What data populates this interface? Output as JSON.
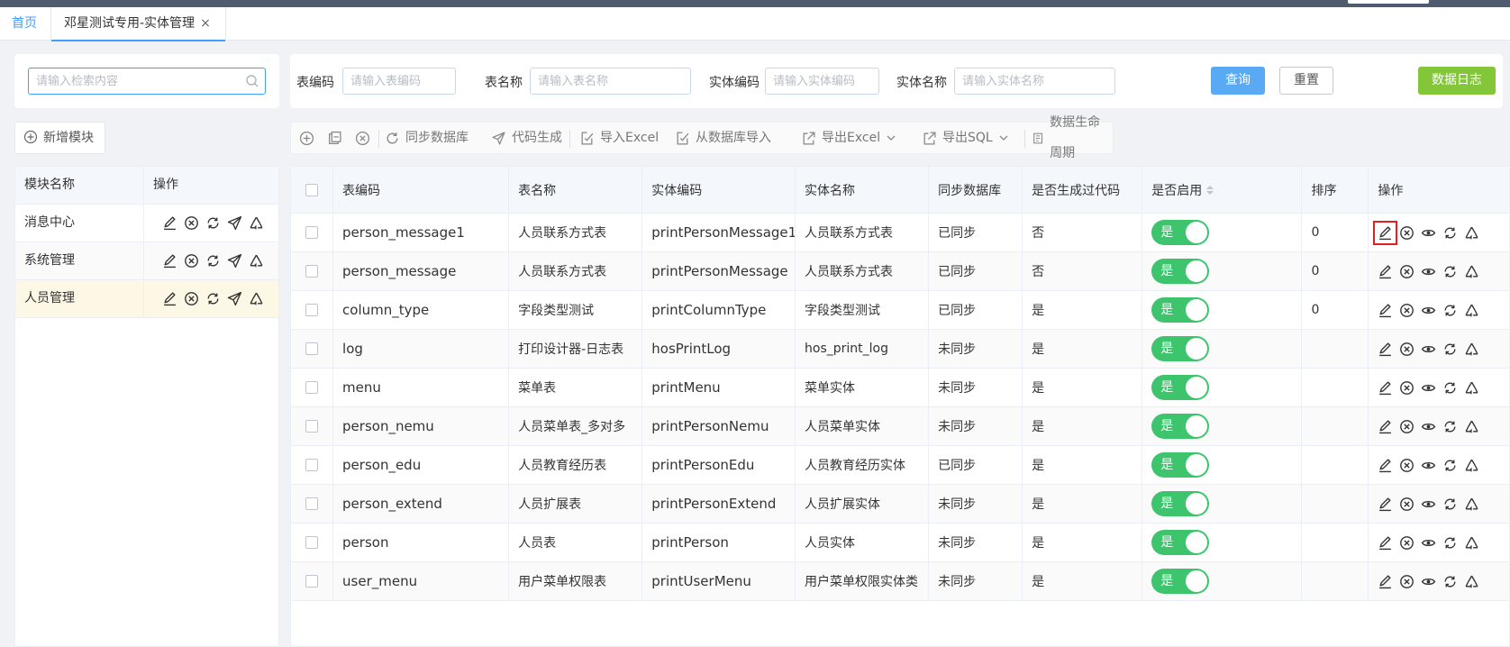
{
  "tabs": {
    "home": "首页",
    "active": "邓星测试专用-实体管理",
    "close": "×"
  },
  "left": {
    "search_placeholder": "请输入检索内容",
    "add_module": "新增模块",
    "header": {
      "name": "模块名称",
      "ops": "操作"
    },
    "modules": [
      {
        "name": "消息中心"
      },
      {
        "name": "系统管理"
      },
      {
        "name": "人员管理"
      }
    ]
  },
  "filters": {
    "table_code_label": "表编码",
    "table_code_placeholder": "请输入表编码",
    "table_name_label": "表名称",
    "table_name_placeholder": "请输入表名称",
    "entity_code_label": "实体编码",
    "entity_code_placeholder": "请输入实体编码",
    "entity_name_label": "实体名称",
    "entity_name_placeholder": "请输入实体名称",
    "query": "查询",
    "reset": "重置",
    "data_log": "数据日志"
  },
  "toolbar": {
    "sync_db": "同步数据库",
    "code_gen": "代码生成",
    "import_excel": "导入Excel",
    "import_db": "从数据库导入",
    "export_excel": "导出Excel",
    "export_sql": "导出SQL",
    "lifecycle": "数据生命周期"
  },
  "table": {
    "headers": {
      "code": "表编码",
      "name": "表名称",
      "ecode": "实体编码",
      "ename": "实体名称",
      "sync": "同步数据库",
      "gen": "是否生成过代码",
      "enable": "是否启用",
      "sort": "排序",
      "ops": "操作"
    },
    "rows": [
      {
        "code": "person_message1",
        "name": "人员联系方式表",
        "ecode": "printPersonMessage1",
        "ename": "人员联系方式表",
        "sync": "已同步",
        "gen": "否",
        "enable": "是",
        "sort": "0"
      },
      {
        "code": "person_message",
        "name": "人员联系方式表",
        "ecode": "printPersonMessage",
        "ename": "人员联系方式表",
        "sync": "已同步",
        "gen": "否",
        "enable": "是",
        "sort": "0"
      },
      {
        "code": "column_type",
        "name": "字段类型测试",
        "ecode": "printColumnType",
        "ename": "字段类型测试",
        "sync": "已同步",
        "gen": "是",
        "enable": "是",
        "sort": "0"
      },
      {
        "code": "log",
        "name": "打印设计器-日志表",
        "ecode": "hosPrintLog",
        "ename": "hos_print_log",
        "sync": "未同步",
        "gen": "是",
        "enable": "是",
        "sort": ""
      },
      {
        "code": "menu",
        "name": "菜单表",
        "ecode": "printMenu",
        "ename": "菜单实体",
        "sync": "未同步",
        "gen": "是",
        "enable": "是",
        "sort": ""
      },
      {
        "code": "person_nemu",
        "name": "人员菜单表_多对多",
        "ecode": "printPersonNemu",
        "ename": "人员菜单实体",
        "sync": "未同步",
        "gen": "是",
        "enable": "是",
        "sort": ""
      },
      {
        "code": "person_edu",
        "name": "人员教育经历表",
        "ecode": "printPersonEdu",
        "ename": "人员教育经历实体",
        "sync": "已同步",
        "gen": "是",
        "enable": "是",
        "sort": ""
      },
      {
        "code": "person_extend",
        "name": "人员扩展表",
        "ecode": "printPersonExtend",
        "ename": "人员扩展实体",
        "sync": "未同步",
        "gen": "是",
        "enable": "是",
        "sort": ""
      },
      {
        "code": "person",
        "name": "人员表",
        "ecode": "printPerson",
        "ename": "人员实体",
        "sync": "未同步",
        "gen": "是",
        "enable": "是",
        "sort": ""
      },
      {
        "code": "user_menu",
        "name": "用户菜单权限表",
        "ecode": "printUserMenu",
        "ename": "用户菜单权限实体类",
        "sync": "未同步",
        "gen": "是",
        "enable": "是",
        "sort": ""
      }
    ]
  },
  "colors": {
    "primary": "#409eff",
    "success": "#3ec46d",
    "log_button": "#83c63a",
    "highlight": "#e02020"
  }
}
